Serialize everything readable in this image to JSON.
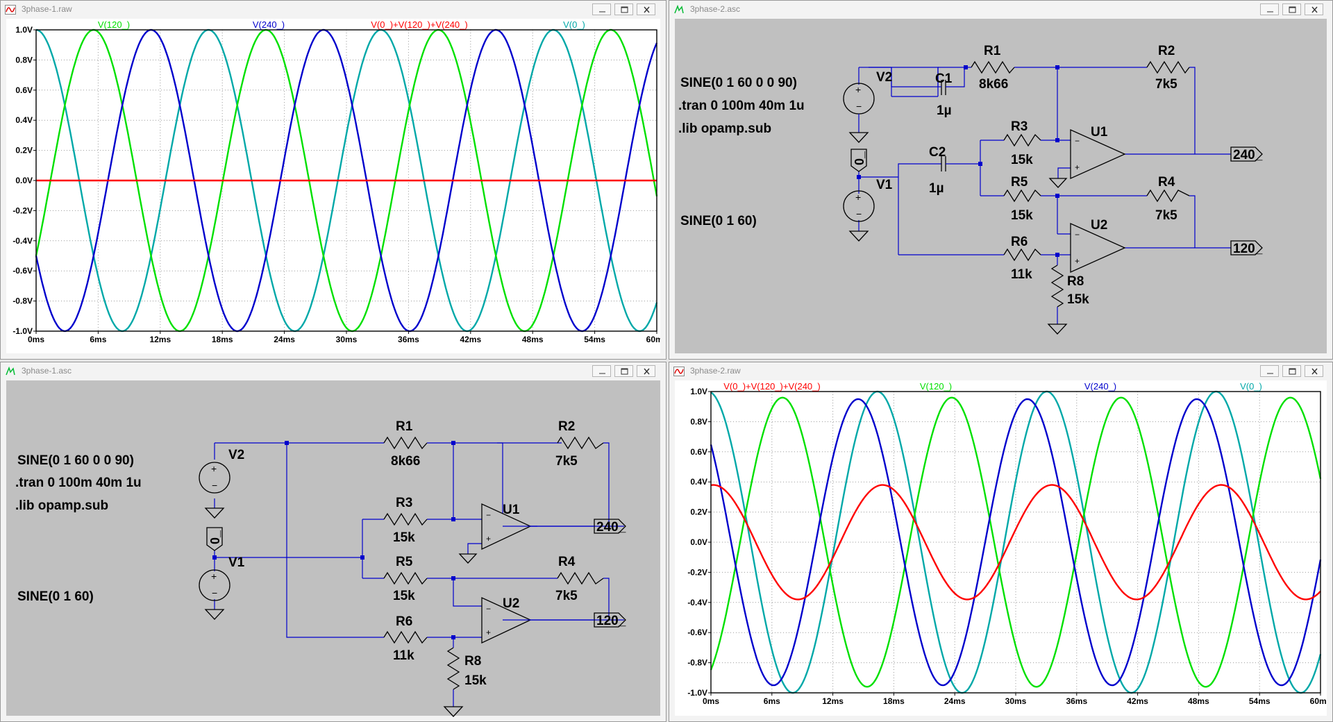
{
  "windows": {
    "tl": {
      "title": "3phase-1.raw"
    },
    "tr": {
      "title": "3phase-2.asc"
    },
    "bl": {
      "title": "3phase-1.asc"
    },
    "br": {
      "title": "3phase-2.raw"
    }
  },
  "plots": {
    "tl": {
      "trace_labels": [
        {
          "text": "V(120_)",
          "color": "#00e000"
        },
        {
          "text": "V(240_)",
          "color": "#0000cc"
        },
        {
          "text": "V(0_)+V(120_)+V(240_)",
          "color": "#ff0000"
        },
        {
          "text": "V(0_)",
          "color": "#00a8a8"
        }
      ],
      "yticks": [
        "1.0V",
        "0.8V",
        "0.6V",
        "0.4V",
        "0.2V",
        "0.0V",
        "-0.2V",
        "-0.4V",
        "-0.6V",
        "-0.8V",
        "-1.0V"
      ],
      "xticks": [
        "0ms",
        "6ms",
        "12ms",
        "18ms",
        "24ms",
        "30ms",
        "36ms",
        "42ms",
        "48ms",
        "54ms",
        "60ms"
      ]
    },
    "br": {
      "trace_labels": [
        {
          "text": "V(0_)+V(120_)+V(240_)",
          "color": "#ff0000"
        },
        {
          "text": "V(120_)",
          "color": "#00e000"
        },
        {
          "text": "V(240_)",
          "color": "#0000cc"
        },
        {
          "text": "V(0_)",
          "color": "#00a8a8"
        }
      ],
      "yticks": [
        "1.0V",
        "0.8V",
        "0.6V",
        "0.4V",
        "0.2V",
        "0.0V",
        "-0.2V",
        "-0.4V",
        "-0.6V",
        "-0.8V",
        "-1.0V"
      ],
      "xticks": [
        "0ms",
        "6ms",
        "12ms",
        "18ms",
        "24ms",
        "30ms",
        "36ms",
        "42ms",
        "48ms",
        "54ms",
        "60ms"
      ]
    }
  },
  "chart_data": [
    {
      "type": "line",
      "xlabel": "",
      "ylabel": "",
      "x_unit": "ms",
      "xlim": [
        0,
        60
      ],
      "ylim": [
        -1.0,
        1.0
      ],
      "grid": true,
      "series": [
        {
          "name": "V(0_)",
          "color": "#00a8a8",
          "function": "sin(2*pi*60*t + 90deg)",
          "amplitude": 1.0
        },
        {
          "name": "V(120_)",
          "color": "#00e000",
          "function": "sin(2*pi*60*t - 30deg)",
          "amplitude": 1.0
        },
        {
          "name": "V(240_)",
          "color": "#0000cc",
          "function": "sin(2*pi*60*t - 150deg)",
          "amplitude": 1.0
        },
        {
          "name": "V(0_)+V(120_)+V(240_)",
          "color": "#ff0000",
          "function": "0",
          "amplitude": 0.0
        }
      ]
    },
    {
      "type": "line",
      "xlabel": "",
      "ylabel": "",
      "x_unit": "ms",
      "xlim": [
        0,
        60
      ],
      "ylim": [
        -1.0,
        1.0
      ],
      "grid": true,
      "series": [
        {
          "name": "V(0_)",
          "color": "#00a8a8",
          "function": "sin(2*pi*60*t + 96deg)",
          "amplitude": 1.0
        },
        {
          "name": "V(120_)",
          "color": "#00e000",
          "function": "sin(2*pi*60*t - 62deg)",
          "amplitude": 0.96
        },
        {
          "name": "V(240_)",
          "color": "#0000cc",
          "function": "sin(2*pi*60*t + 137deg)",
          "amplitude": 0.95
        },
        {
          "name": "V(0_)+V(120_)+V(240_)",
          "color": "#ff0000",
          "function": "sin(2*pi*60*t + 85deg)",
          "amplitude": 0.38
        }
      ]
    }
  ],
  "schematics": {
    "tr": {
      "directives": [
        ".tran 0 100m 40m 1u",
        ".lib opamp.sub"
      ],
      "v2_value": "SINE(0 1 60 0 0 90)",
      "v1_value": "SINE(0 1 60)",
      "components": {
        "V1": "V1",
        "V2": "V2",
        "C1": "C1",
        "C1v": "1µ",
        "C2": "C2",
        "C2v": "1µ",
        "R1": "R1",
        "R1v": "8k66",
        "R2": "R2",
        "R2v": "7k5",
        "R3": "R3",
        "R3v": "15k",
        "R4": "R4",
        "R4v": "7k5",
        "R5": "R5",
        "R5v": "15k",
        "R6": "R6",
        "R6v": "11k",
        "R8": "R8",
        "R8v": "15k",
        "U1": "U1",
        "U2": "U2"
      },
      "nets": {
        "out1": "240_",
        "out2": "120_",
        "gnd_label": "0_"
      }
    },
    "bl": {
      "directives": [
        ".tran 0 100m 40m 1u",
        ".lib opamp.sub"
      ],
      "v2_value": "SINE(0 1 60 0 0 90)",
      "v1_value": "SINE(0 1 60)",
      "components": {
        "V1": "V1",
        "V2": "V2",
        "R1": "R1",
        "R1v": "8k66",
        "R2": "R2",
        "R2v": "7k5",
        "R3": "R3",
        "R3v": "15k",
        "R4": "R4",
        "R4v": "7k5",
        "R5": "R5",
        "R5v": "15k",
        "R6": "R6",
        "R6v": "11k",
        "R8": "R8",
        "R8v": "15k",
        "U1": "U1",
        "U2": "U2"
      },
      "nets": {
        "out1": "240_",
        "out2": "120_",
        "gnd_label": "0_"
      }
    }
  }
}
